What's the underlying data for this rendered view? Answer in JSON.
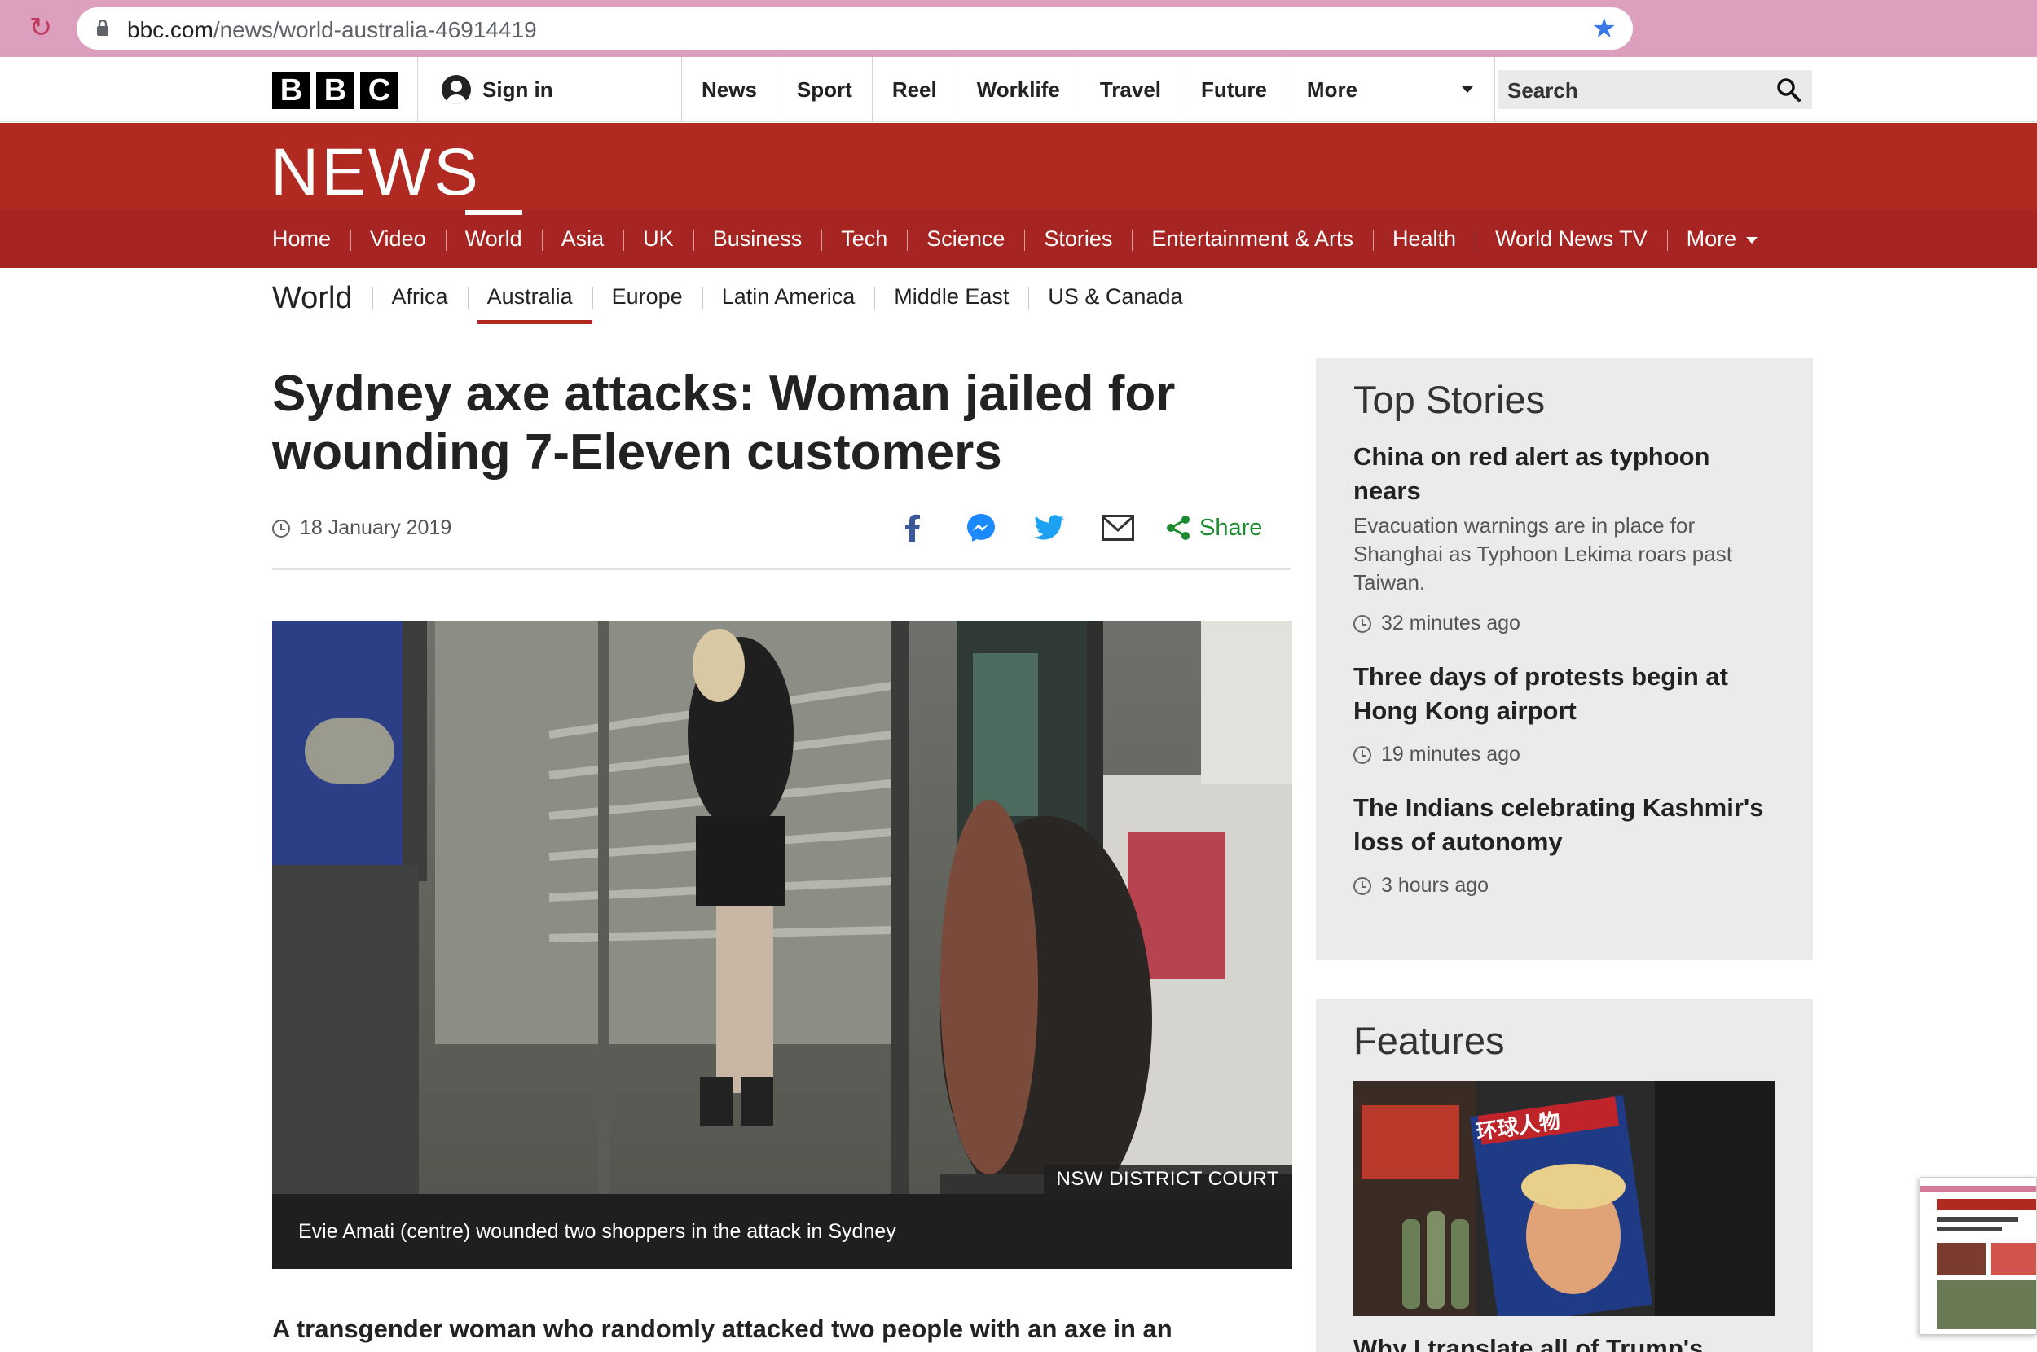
{
  "browser": {
    "url_domain": "bbc.com",
    "url_path": "/news/world-australia-46914419"
  },
  "header": {
    "logo_letters": [
      "B",
      "B",
      "C"
    ],
    "sign_in": "Sign in",
    "nav": [
      "News",
      "Sport",
      "Reel",
      "Worklife",
      "Travel",
      "Future"
    ],
    "more": "More",
    "search_placeholder": "Search"
  },
  "news": {
    "wordmark": "NEWS",
    "nav": [
      "Home",
      "Video",
      "World",
      "Asia",
      "UK",
      "Business",
      "Tech",
      "Science",
      "Stories",
      "Entertainment & Arts",
      "Health",
      "World News TV"
    ],
    "active": "World",
    "more": "More"
  },
  "subnav": {
    "title": "World",
    "items": [
      "Africa",
      "Australia",
      "Europe",
      "Latin America",
      "Middle East",
      "US & Canada"
    ],
    "active": "Australia"
  },
  "article": {
    "headline": "Sydney axe attacks: Woman jailed for wounding 7-Eleven customers",
    "date": "18 January 2019",
    "share_label": "Share",
    "image_credit": "NSW DISTRICT COURT",
    "caption": "Evie Amati (centre) wounded two shoppers in the attack in Sydney",
    "lede": "A transgender woman who randomly attacked two people with an axe in an"
  },
  "top_stories": {
    "heading": "Top Stories",
    "items": [
      {
        "title": "China on red alert as typhoon nears",
        "summary": "Evacuation warnings are in place for Shanghai as Typhoon Lekima roars past Taiwan.",
        "time": "32 minutes ago"
      },
      {
        "title": "Three days of protests begin at Hong Kong airport",
        "summary": "",
        "time": "19 minutes ago"
      },
      {
        "title": "The Indians celebrating Kashmir's loss of autonomy",
        "summary": "",
        "time": "3 hours ago"
      }
    ]
  },
  "features": {
    "heading": "Features",
    "magazine_title": "环球人物",
    "first_title": "Why I translate all of Trump's"
  },
  "colors": {
    "bbc_red": "#b02a22",
    "bbc_red_nav": "#a62421",
    "share_green": "#1c8b2f",
    "chrome_pink": "#dca0be",
    "bookmark_blue": "#3b78e7"
  }
}
